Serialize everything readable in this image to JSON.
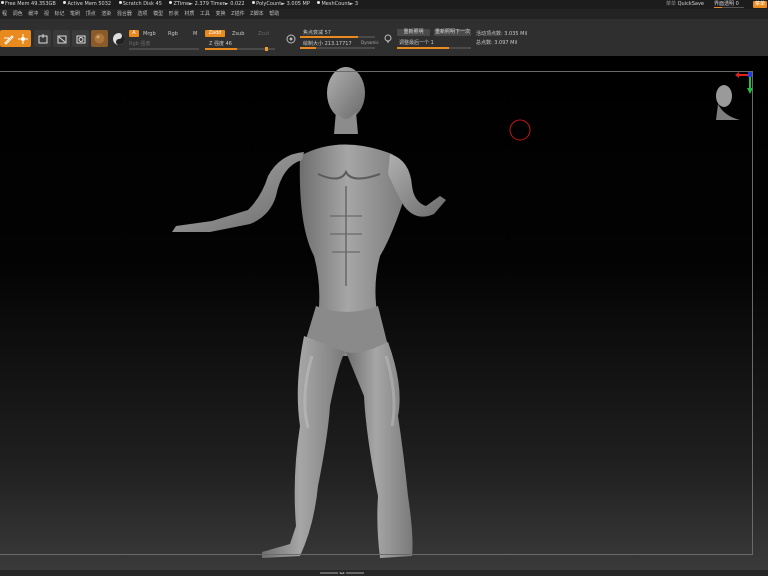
{
  "titlebar": {
    "free_mem": "Free Mem 49.353GB",
    "active_mem": "Active Mem 5032",
    "scratch_disk": "Scratch Disk 45",
    "ztime": "ZTime► 2.379 Timer► 0.022",
    "poly_count": "PolyCount► 3.005 MP",
    "mesh_count": "MeshCount► 3",
    "right_label_1": "菜单",
    "quicksave": "QuickSave",
    "transparency": "界面透明 0",
    "right_btn": "菜单"
  },
  "menubar": {
    "items": [
      "程",
      "调色",
      "缓冲",
      "视",
      "标记",
      "笔刷",
      "顶点",
      "渲染",
      "混合器",
      "选项",
      "模型",
      "形状",
      "材质",
      "工具",
      "变换",
      "Z插件",
      "Z脚本",
      "帮助"
    ]
  },
  "toolbar": {
    "btn_edit": "编辑",
    "btn_draw": "绘制",
    "btn_move": "移动",
    "btn_scale": "缩放",
    "btn_rotate": "旋转",
    "a_label": "A",
    "mrgb": "Mrgb",
    "rgb": "Rgb",
    "m": "M",
    "rgb_intensity": "Rgb 强度",
    "zadd": "Zadd",
    "zsub": "Zsub",
    "zcut": "Zcut",
    "z_intensity": "Z 强度 46",
    "focal_shift": "焦点衰减 57",
    "draw_size": "绘制大小 213.17717",
    "dynamic": "Dynamic",
    "btn_relight": "重新照明",
    "btn_relight_next": "重新照明下一次",
    "adjust_last": "调整最后一个 1",
    "active_points": "活动顶点数: 3.035 Mil",
    "total_points": "总点数: 3.097 Mil"
  },
  "bottom": {
    "scroll_label": "◂▴▸"
  },
  "colors": {
    "accent": "#e98a1e",
    "toolbar_bg": "#2f2f2f",
    "titlebar_bg": "#1c1c1c",
    "axis_x": "#e02020",
    "axis_y": "#20c040",
    "axis_z": "#2040e0"
  }
}
